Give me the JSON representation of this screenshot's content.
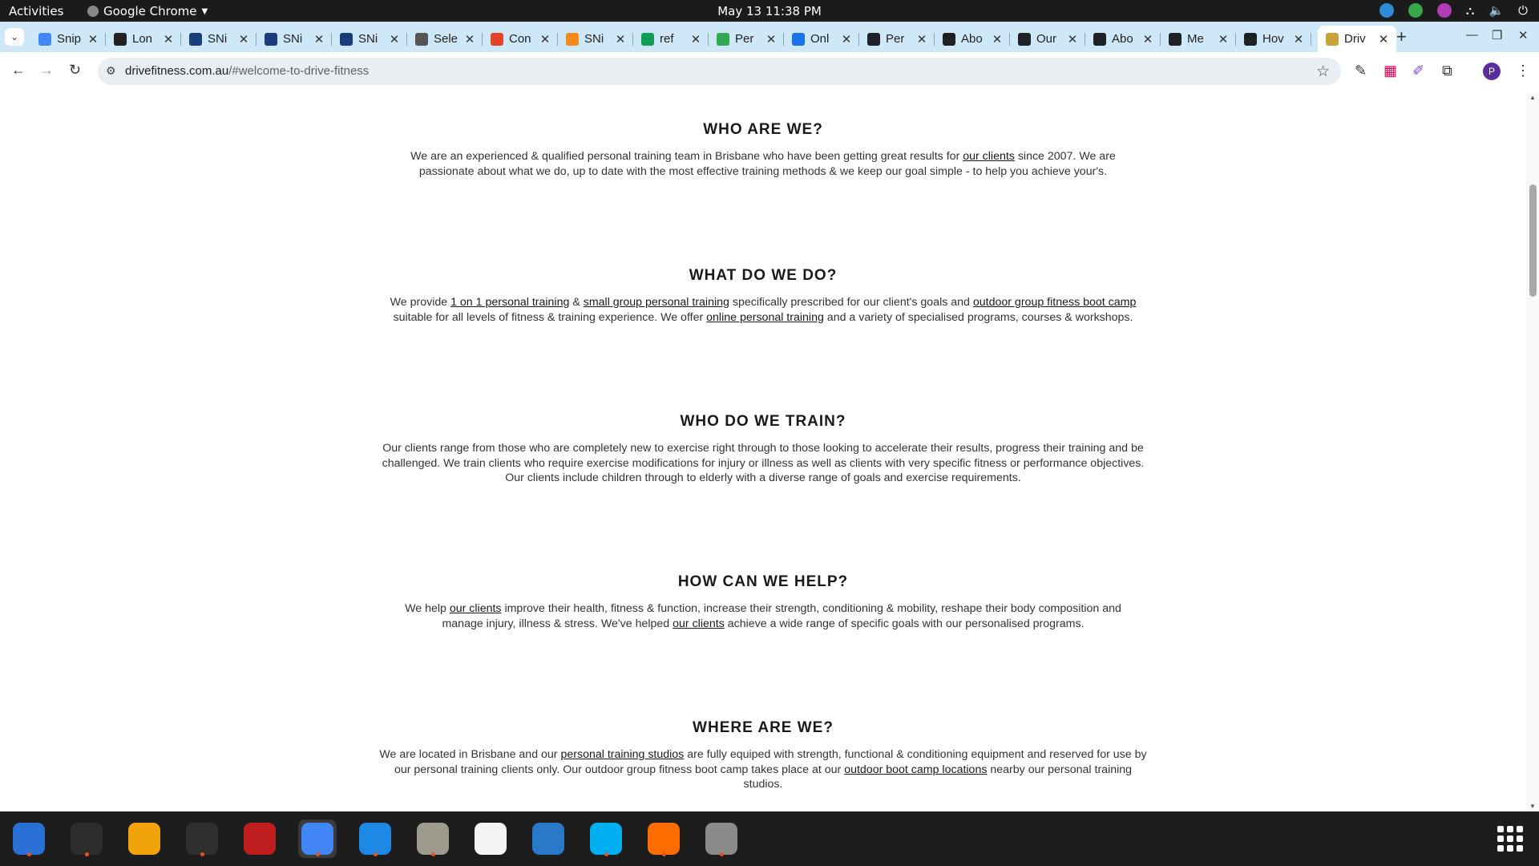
{
  "system_bar": {
    "activities": "Activities",
    "app_name": "Google Chrome",
    "clock": "May 13  11:38 PM"
  },
  "tabs": [
    {
      "title": "Snip",
      "icon": "docs-icon",
      "color": "#4285f4"
    },
    {
      "title": "Lon",
      "icon": "l-icon",
      "color": "#222222"
    },
    {
      "title": "SNi",
      "icon": "snp-icon",
      "color": "#1a3d7c"
    },
    {
      "title": "SNi",
      "icon": "snp-icon",
      "color": "#1a3d7c"
    },
    {
      "title": "SNi",
      "icon": "snp-icon",
      "color": "#1a3d7c"
    },
    {
      "title": "Sele",
      "icon": "globe-icon",
      "color": "#555555"
    },
    {
      "title": "Con",
      "icon": "gitlab-icon",
      "color": "#e24329"
    },
    {
      "title": "SNi",
      "icon": "swirl-icon",
      "color": "#f28b1e"
    },
    {
      "title": "ref",
      "icon": "sheets-icon",
      "color": "#0f9d58"
    },
    {
      "title": "Per",
      "icon": "leaf-icon",
      "color": "#34a853"
    },
    {
      "title": "Onl",
      "icon": "info-icon",
      "color": "#1a73e8"
    },
    {
      "title": "Per",
      "icon": "openai-icon",
      "color": "#202124"
    },
    {
      "title": "Abo",
      "icon": "openai-icon",
      "color": "#202124"
    },
    {
      "title": "Our",
      "icon": "openai-icon",
      "color": "#202124"
    },
    {
      "title": "Abo",
      "icon": "openai-icon",
      "color": "#202124"
    },
    {
      "title": "Me",
      "icon": "openai-icon",
      "color": "#202124"
    },
    {
      "title": "Hov",
      "icon": "openai-icon",
      "color": "#202124"
    },
    {
      "title": "Driv",
      "icon": "drive-fitness-icon",
      "color": "#c8a33c",
      "active": true
    }
  ],
  "address_bar": {
    "host": "drivefitness.com.au",
    "path": "/#welcome-to-drive-fitness"
  },
  "profile_initial": "P",
  "sections": [
    {
      "heading": "WHO ARE WE?",
      "parts": [
        {
          "t": "We are an experienced & qualified personal training team in Brisbane who have been getting great results for "
        },
        {
          "t": "our clients",
          "link": true
        },
        {
          "t": " since 2007. We are passionate about what we do, up to date with the most effective training methods & we keep our goal simple - to help you achieve your's."
        }
      ]
    },
    {
      "heading": "WHAT DO WE DO?",
      "parts": [
        {
          "t": "We provide "
        },
        {
          "t": "1 on 1  personal training",
          "link": true
        },
        {
          "t": " & "
        },
        {
          "t": "small group personal training",
          "link": true
        },
        {
          "t": " specifically prescribed for our client's goals and "
        },
        {
          "t": "outdoor group fitness boot camp",
          "link": true
        },
        {
          "t": " suitable for all levels of fitness & training experience. We offer "
        },
        {
          "t": "online personal training",
          "link": true
        },
        {
          "t": " and a variety of specialised programs, courses & workshops."
        }
      ]
    },
    {
      "heading": "WHO DO WE TRAIN?",
      "parts": [
        {
          "t": "Our clients range from those who are completely new to exercise right through to those looking to accelerate their results, progress their training and be challenged. We train clients who require exercise modifications for injury or illness as well as clients with very specific fitness or performance objectives. Our clients include children through to elderly with a diverse range of goals and exercise requirements."
        }
      ]
    },
    {
      "heading": "HOW CAN WE HELP?",
      "parts": [
        {
          "t": "We help "
        },
        {
          "t": "our clients",
          "link": true
        },
        {
          "t": " improve their health, fitness & function, increase their strength, conditioning & mobility, reshape their body composition and manage injury, illness & stress. We've helped "
        },
        {
          "t": "our clients",
          "link": true
        },
        {
          "t": " achieve a wide range of specific goals with our personalised programs."
        }
      ]
    },
    {
      "heading": "WHERE ARE WE?",
      "parts": [
        {
          "t": "We are located in Brisbane and our "
        },
        {
          "t": "personal training studios",
          "link": true
        },
        {
          "t": " are fully equiped with strength, functional & conditioning equipment and reserved for use by our personal training clients only. Our outdoor group fitness boot camp takes place at our "
        },
        {
          "t": "outdoor boot camp locations",
          "link": true
        },
        {
          "t": " nearby our personal training studios."
        }
      ]
    }
  ],
  "dock": [
    {
      "name": "thunderbird-icon",
      "color": "#2a6fd6",
      "running": true
    },
    {
      "name": "terminal-icon",
      "color": "#2c2c2c",
      "running": true
    },
    {
      "name": "calculator-icon",
      "color": "#f0a30a",
      "running": false
    },
    {
      "name": "system-monitor-icon",
      "color": "#2f2f2f",
      "running": true
    },
    {
      "name": "filezilla-icon",
      "color": "#bf1e1e",
      "running": false
    },
    {
      "name": "chrome-icon",
      "color": "#4285f4",
      "running": true
    },
    {
      "name": "vscode-icon",
      "color": "#1e88e5",
      "running": true
    },
    {
      "name": "files-icon",
      "color": "#9e9a8e",
      "running": true
    },
    {
      "name": "text-editor-icon",
      "color": "#f4f4f4",
      "running": false
    },
    {
      "name": "libreoffice-writer-icon",
      "color": "#2a79c8",
      "running": false
    },
    {
      "name": "skype-icon",
      "color": "#00aff0",
      "running": true
    },
    {
      "name": "firefox-dev-icon",
      "color": "#ff6d00",
      "running": true
    },
    {
      "name": "disk-utility-icon",
      "color": "#8a8a8a",
      "running": true
    }
  ]
}
